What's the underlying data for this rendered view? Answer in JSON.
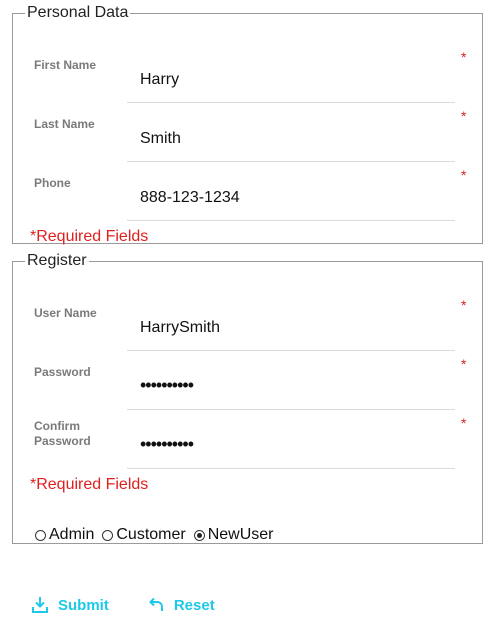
{
  "personal": {
    "legend": "Personal Data",
    "fields": [
      {
        "label": "First Name",
        "value": "Harry",
        "required_mark": "*"
      },
      {
        "label": "Last Name",
        "value": "Smith",
        "required_mark": "*"
      },
      {
        "label": "Phone",
        "value": "888-123-1234",
        "required_mark": "*"
      }
    ],
    "required_note": "*Required Fields"
  },
  "register": {
    "legend": "Register",
    "fields": [
      {
        "label": "User Name",
        "value": "HarrySmith",
        "required_mark": "*"
      },
      {
        "label": "Password",
        "value": "••••••••••",
        "required_mark": "*"
      },
      {
        "label_line1": "Confirm",
        "label_line2": "Password",
        "value": "••••••••••",
        "required_mark": "*"
      }
    ],
    "required_note": "*Required Fields",
    "roles": [
      {
        "label": "Admin",
        "selected": false
      },
      {
        "label": "Customer",
        "selected": false
      },
      {
        "label": "NewUser",
        "selected": true
      }
    ]
  },
  "actions": {
    "submit_label": "Submit",
    "submit_icon": "download-tray-icon",
    "reset_label": "Reset",
    "reset_icon": "undo-arrow-icon",
    "accent_color": "#1ec8e8"
  },
  "colors": {
    "required": "#e02020",
    "label": "#7a7a7a",
    "border": "#9a9a9a"
  }
}
